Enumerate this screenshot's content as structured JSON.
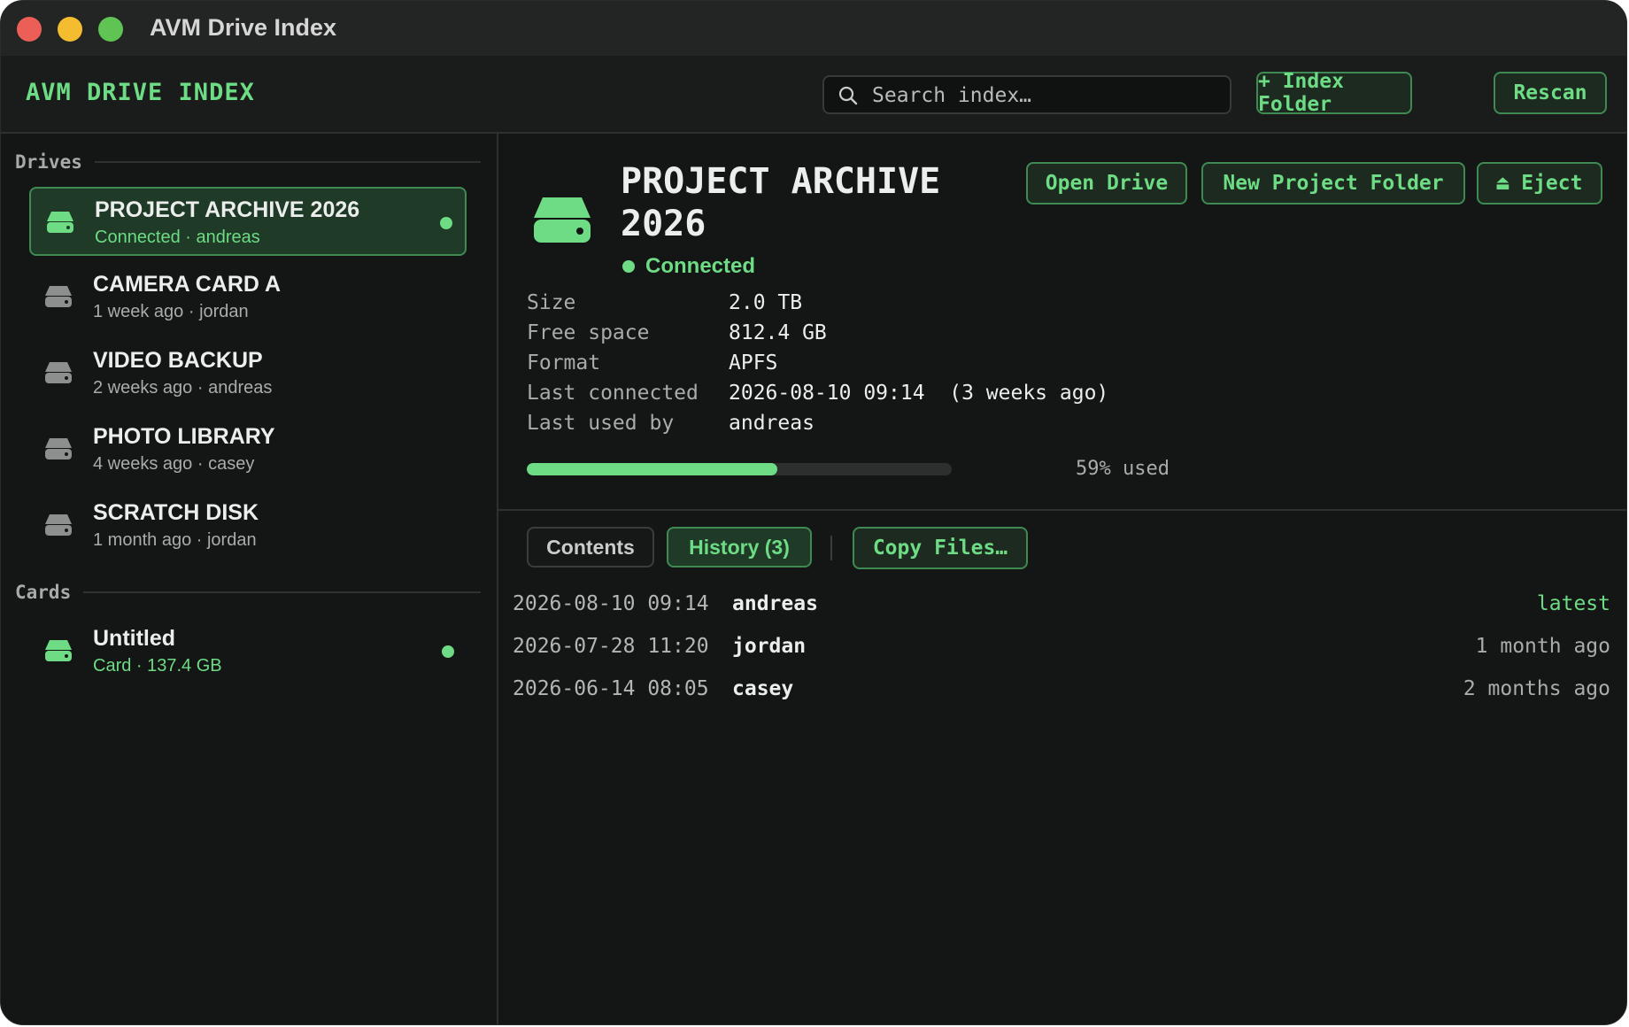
{
  "window": {
    "title": "AVM Drive Index"
  },
  "toolbar": {
    "app_name": "AVM DRIVE INDEX",
    "search_placeholder": "Search index…",
    "index_folder_label": "+ Index Folder",
    "rescan_label": "Rescan"
  },
  "sidebar": {
    "drives_heading": "Drives",
    "drives": [
      {
        "name": "PROJECT ARCHIVE 2026",
        "sub": "Connected · andreas",
        "selected": true,
        "connected": true
      },
      {
        "name": "CAMERA CARD A",
        "sub": "1 week ago · jordan"
      },
      {
        "name": "VIDEO BACKUP",
        "sub": "2 weeks ago · andreas"
      },
      {
        "name": "PHOTO LIBRARY",
        "sub": "4 weeks ago · casey"
      },
      {
        "name": "SCRATCH DISK",
        "sub": "1 month ago · jordan"
      }
    ],
    "cards_heading": "Cards",
    "cards": [
      {
        "name": "Untitled",
        "sub": "Card · 137.4 GB",
        "connected": true
      }
    ]
  },
  "detail": {
    "title": "PROJECT ARCHIVE 2026",
    "status": "Connected",
    "actions": {
      "open": "Open Drive",
      "new_folder": "New Project Folder",
      "eject": "⏏ Eject"
    },
    "properties": [
      {
        "key": "Size",
        "value": "2.0 TB"
      },
      {
        "key": "Free space",
        "value": "812.4 GB"
      },
      {
        "key": "Format",
        "value": "APFS"
      },
      {
        "key": "Last connected",
        "value": "2026-08-10 09:14  (3 weeks ago)"
      },
      {
        "key": "Last used by",
        "value": "andreas"
      }
    ],
    "usage_percent": 59,
    "usage_label": "59% used",
    "tabs": {
      "contents": "Contents",
      "history": "History (3)",
      "copy": "Copy Files…"
    },
    "history": [
      {
        "date": "2026-08-10 09:14",
        "user": "andreas",
        "relative": "latest"
      },
      {
        "date": "2026-07-28 11:20",
        "user": "jordan",
        "relative": "1 month ago"
      },
      {
        "date": "2026-06-14 08:05",
        "user": "casey",
        "relative": "2 months ago"
      }
    ]
  },
  "colors": {
    "accent": "#6ddc84",
    "background": "#141615",
    "selected_bg": "#1f3a27",
    "inactive_icon": "#8c8f8d"
  }
}
